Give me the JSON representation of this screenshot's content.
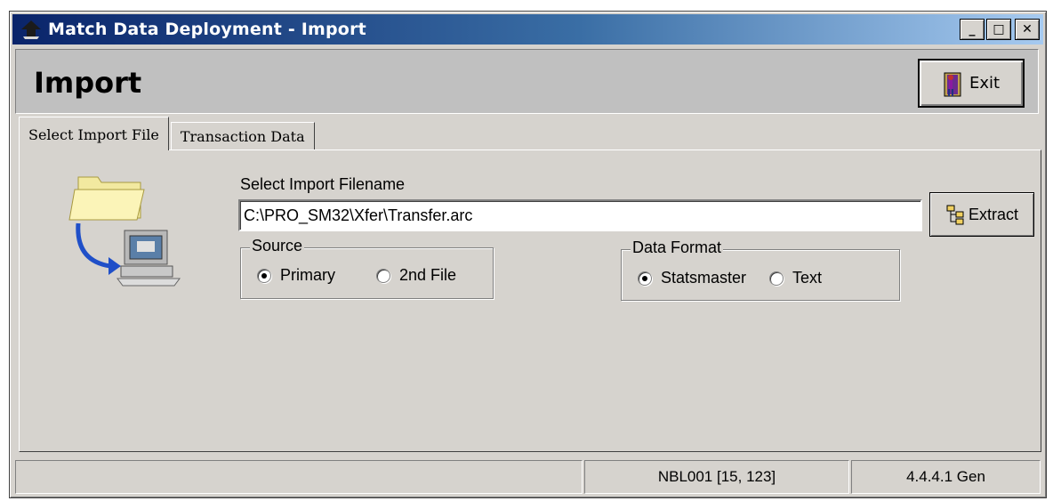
{
  "window": {
    "title": "Match Data Deployment - Import",
    "minimize_label": "_",
    "maximize_label": "□",
    "close_label": "✕"
  },
  "header": {
    "title": "Import",
    "exit_label": "Exit"
  },
  "tabs": [
    {
      "label": "Select Import File",
      "active": true
    },
    {
      "label": "Transaction Data",
      "active": false
    }
  ],
  "import_file": {
    "filename_label": "Select Import Filename",
    "filename_value": "C:\\PRO_SM32\\Xfer\\Transfer.arc",
    "extract_label": "Extract",
    "source": {
      "legend": "Source",
      "options": [
        {
          "label": "Primary",
          "selected": true
        },
        {
          "label": "2nd File",
          "selected": false
        }
      ]
    },
    "data_format": {
      "legend": "Data Format",
      "options": [
        {
          "label": "Statsmaster",
          "selected": true
        },
        {
          "label": "Text",
          "selected": false
        }
      ]
    }
  },
  "statusbar": {
    "pane1": "",
    "pane2": "NBL001 [15, 123]",
    "pane3": "4.4.4.1 Gen"
  },
  "icons": {
    "app": "app-icon",
    "exit": "exit-door-icon",
    "extract": "extract-tree-icon",
    "import": "folder-to-computer-icon"
  }
}
